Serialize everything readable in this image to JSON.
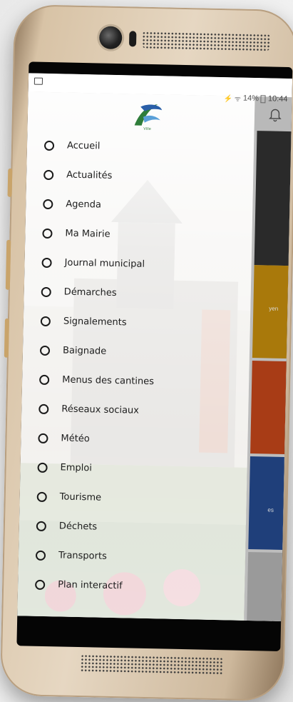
{
  "status_bar": {
    "icons_text": "⚡ ᯤ",
    "battery": "14%",
    "time": "10:44"
  },
  "app": {
    "tile_texts": [
      "yen",
      "es"
    ]
  },
  "drawer": {
    "logo_text": "Ville",
    "items": [
      {
        "label": "Accueil",
        "icon": "home-icon"
      },
      {
        "label": "Actualités",
        "icon": "news-icon"
      },
      {
        "label": "Agenda",
        "icon": "calendar-icon"
      },
      {
        "label": "Ma Mairie",
        "icon": "town-hall-icon"
      },
      {
        "label": "Journal municipal",
        "icon": "journal-icon"
      },
      {
        "label": "Démarches",
        "icon": "info-icon"
      },
      {
        "label": "Signalements",
        "icon": "alert-icon"
      },
      {
        "label": "Baignade",
        "icon": "swimming-icon"
      },
      {
        "label": "Menus des cantines",
        "icon": "menu-icon"
      },
      {
        "label": "Réseaux sociaux",
        "icon": "social-icon"
      },
      {
        "label": "Météo",
        "icon": "weather-icon"
      },
      {
        "label": "Emploi",
        "icon": "job-icon"
      },
      {
        "label": "Tourisme",
        "icon": "tourism-icon"
      },
      {
        "label": "Déchets",
        "icon": "waste-icon"
      },
      {
        "label": "Transports",
        "icon": "transport-icon"
      },
      {
        "label": "Plan interactif",
        "icon": "map-icon"
      }
    ]
  },
  "colors": {
    "tile_gold": "#a9790b",
    "tile_red": "#a83c16",
    "tile_blue": "#1f3f7a"
  }
}
